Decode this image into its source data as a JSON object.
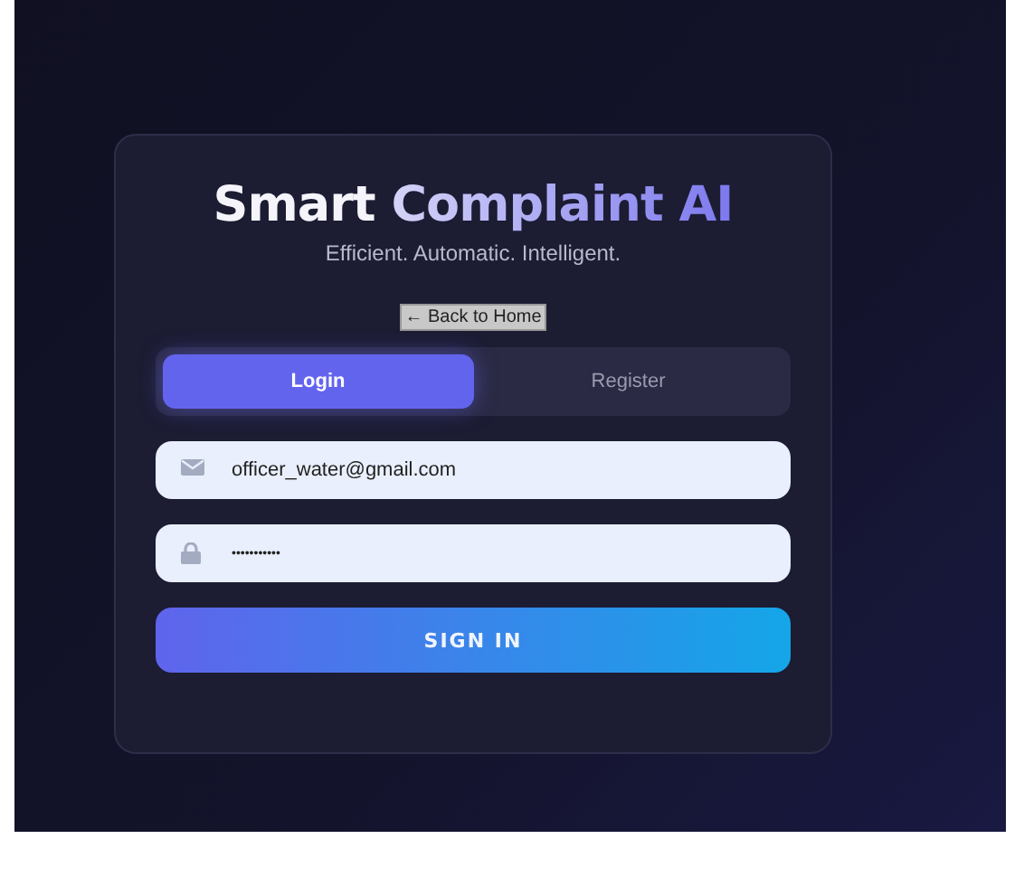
{
  "title": {
    "lead": "Smart",
    "accent": "Complaint AI"
  },
  "tagline": "Efficient. Automatic. Intelligent.",
  "back_link": "← Back to Home",
  "tabs": [
    {
      "label": "Login",
      "selected": true
    },
    {
      "label": "Register",
      "selected": false
    }
  ],
  "fields": [
    {
      "kind": "email",
      "value": "officer_water@gmail.com"
    },
    {
      "kind": "password",
      "value": "•••••••••••"
    }
  ],
  "submit": "SIGN IN"
}
